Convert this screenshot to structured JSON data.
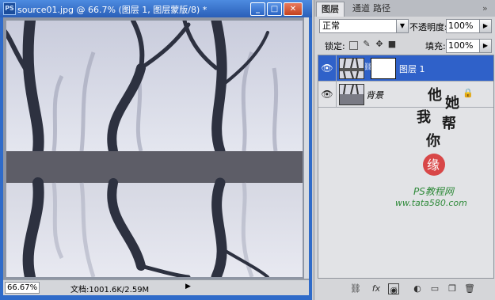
{
  "window": {
    "logo": "PS",
    "title": "source01.jpg @ 66.7% (图层 1, 图层蒙版/8) *",
    "min": "_",
    "max": "□",
    "close": "✕"
  },
  "status": {
    "zoom": "66.67%",
    "doc_info": "文档:1001.6K/2.59M",
    "arrow": "▶"
  },
  "panel": {
    "tabs": [
      "图层",
      "通道",
      "路径"
    ],
    "tab_close": "»",
    "blend_mode": "正常",
    "opacity_label": "不透明度:",
    "opacity_value": "100%",
    "lock_label": "锁定:",
    "fill_label": "填充:",
    "fill_value": "100%",
    "layers": [
      {
        "name": "图层 1",
        "selected": true,
        "visible": true,
        "has_mask": true
      },
      {
        "name": "背景",
        "selected": false,
        "visible": true,
        "locked": true
      }
    ],
    "bottom_icons": [
      "link-icon",
      "fx-icon",
      "add-mask-icon",
      "adjustment-icon",
      "group-icon",
      "new-layer-icon",
      "trash-icon"
    ]
  },
  "watermark": {
    "calligraphy": [
      "他",
      "她",
      "我",
      "帮",
      "你"
    ],
    "seal": "缘",
    "line1": "PS教程网",
    "line2": "www.tata580.com"
  },
  "colors": {
    "title_blue": "#2f61c9",
    "selected_layer": "#2f61c9",
    "watermark_green": "#2f8a3a",
    "seal_red": "#d62b2b"
  }
}
